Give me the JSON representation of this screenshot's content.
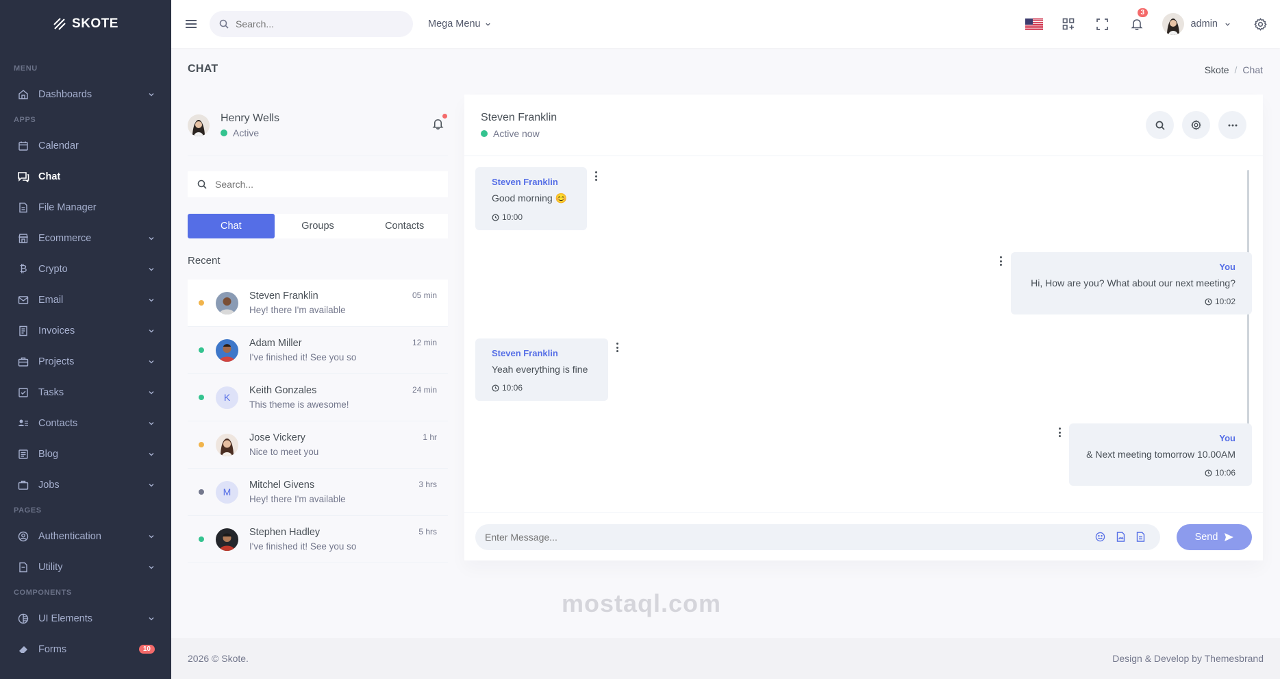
{
  "brand": {
    "name": "SKOTE"
  },
  "sidebar": {
    "sections": [
      {
        "title": "MENU"
      },
      {
        "title": "APPS"
      },
      {
        "title": "PAGES"
      },
      {
        "title": "COMPONENTS"
      }
    ],
    "items": [
      {
        "label": "Dashboards",
        "icon": "home-icon"
      },
      {
        "label": "Calendar",
        "icon": "calendar-icon"
      },
      {
        "label": "Chat",
        "icon": "chat-icon"
      },
      {
        "label": "File Manager",
        "icon": "file-icon"
      },
      {
        "label": "Ecommerce",
        "icon": "store-icon"
      },
      {
        "label": "Crypto",
        "icon": "bitcoin-icon"
      },
      {
        "label": "Email",
        "icon": "envelope-icon"
      },
      {
        "label": "Invoices",
        "icon": "receipt-icon"
      },
      {
        "label": "Projects",
        "icon": "briefcase-icon"
      },
      {
        "label": "Tasks",
        "icon": "task-icon"
      },
      {
        "label": "Contacts",
        "icon": "contacts-icon"
      },
      {
        "label": "Blog",
        "icon": "blog-icon"
      },
      {
        "label": "Jobs",
        "icon": "jobs-icon"
      },
      {
        "label": "Authentication",
        "icon": "user-circle-icon"
      },
      {
        "label": "Utility",
        "icon": "utility-icon"
      },
      {
        "label": "UI Elements",
        "icon": "tone-icon"
      },
      {
        "label": "Forms",
        "icon": "eraser-icon",
        "badge": "10"
      }
    ]
  },
  "topbar": {
    "search_placeholder": "Search...",
    "mega_menu": "Mega Menu",
    "notification_count": "3",
    "user_name": "admin"
  },
  "page": {
    "title": "CHAT",
    "breadcrumb": {
      "parent": "Skote",
      "separator": "/",
      "current": "Chat"
    }
  },
  "me": {
    "name": "Henry Wells",
    "status": "Active"
  },
  "left": {
    "search_placeholder": "Search...",
    "tabs": [
      "Chat",
      "Groups",
      "Contacts"
    ],
    "recent_title": "Recent",
    "conversations": [
      {
        "name": "Steven Franklin",
        "message": "Hey! there I'm available",
        "time": "05 min",
        "status": "orange"
      },
      {
        "name": "Adam Miller",
        "message": "I've finished it! See you so",
        "time": "12 min",
        "status": "green"
      },
      {
        "name": "Keith Gonzales",
        "message": "This theme is awesome!",
        "time": "24 min",
        "status": "green",
        "initial": "K"
      },
      {
        "name": "Jose Vickery",
        "message": "Nice to meet you",
        "time": "1 hr",
        "status": "orange"
      },
      {
        "name": "Mitchel Givens",
        "message": "Hey! there I'm available",
        "time": "3 hrs",
        "status": "gray",
        "initial": "M"
      },
      {
        "name": "Stephen Hadley",
        "message": "I've finished it! See you so",
        "time": "5 hrs",
        "status": "green"
      }
    ]
  },
  "chat": {
    "contact_name": "Steven Franklin",
    "contact_status": "Active now",
    "messages": [
      {
        "author": "Steven Franklin",
        "text": "Good morning 😊",
        "time": "10:00"
      },
      {
        "author": "You",
        "text": "Hi, How are you? What about our next meeting?",
        "time": "10:02"
      },
      {
        "author": "Steven Franklin",
        "text": "Yeah everything is fine",
        "time": "10:06"
      },
      {
        "author": "You",
        "text": "& Next meeting tomorrow 10.00AM",
        "time": "10:06"
      }
    ],
    "input_placeholder": "Enter Message...",
    "send_label": "Send"
  },
  "footer": {
    "left": "2026 © Skote.",
    "right": "Design & Develop by Themesbrand"
  },
  "watermark": "mostaql.com",
  "colors": {
    "primary": "#556ee6",
    "sidebar": "#2a3042",
    "success": "#34c38f",
    "warning": "#f1b44c",
    "danger": "#f46a6a"
  }
}
